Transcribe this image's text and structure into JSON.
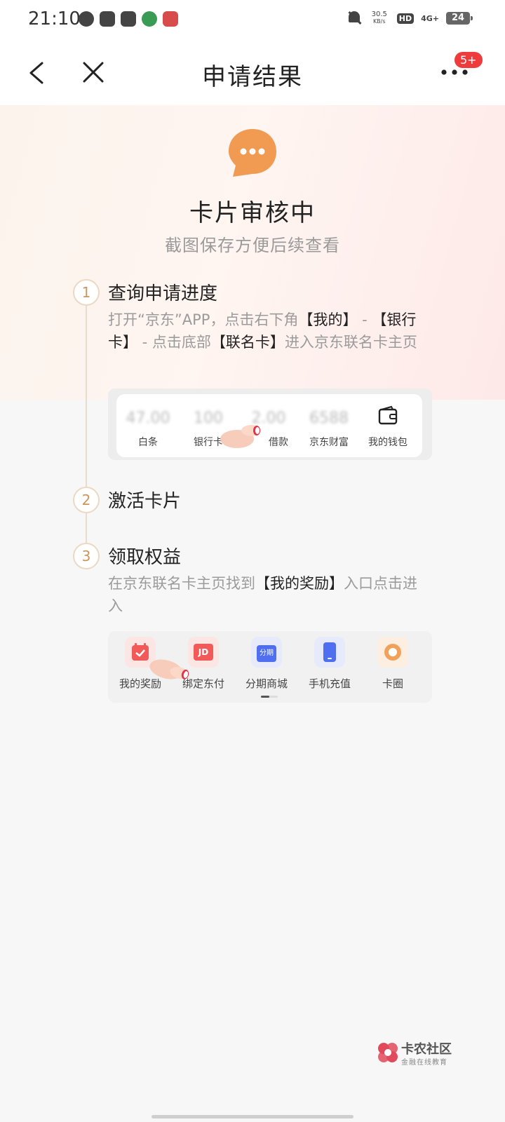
{
  "status_bar": {
    "time": "21:10",
    "speed_value": "30.5",
    "speed_unit": "KB/s",
    "hd": "HD",
    "network": "4G+",
    "battery": "24"
  },
  "nav": {
    "title": "申请结果",
    "badge": "5+"
  },
  "result": {
    "icon": "chat-bubble-icon",
    "title": "卡片审核中",
    "subtitle": "截图保存方便后续查看",
    "accent_color": "#f09a52"
  },
  "steps": [
    {
      "num": "1",
      "title": "查询申请进度",
      "desc_parts": [
        "打开“京东”APP，点击右下角",
        "【我的】",
        " - ",
        "【银行卡】",
        " - 点击底部",
        "【联名卡】",
        "进入京东联名卡主页"
      ]
    },
    {
      "num": "2",
      "title": "激活卡片"
    },
    {
      "num": "3",
      "title": "领取权益",
      "desc_parts": [
        "在京东联名卡主页找到",
        "【我的奖励】",
        "入口点击进入"
      ]
    }
  ],
  "demo1": {
    "items": [
      {
        "value": "47.00",
        "label": "白条"
      },
      {
        "value": "100",
        "label": "银行卡"
      },
      {
        "value": "2.00",
        "label": "借款"
      },
      {
        "value": "6588",
        "label": "京东财富"
      },
      {
        "value": "",
        "label": "我的钱包"
      }
    ]
  },
  "demo2": {
    "items": [
      {
        "label": "我的奖励",
        "icon": "calendar-check-icon",
        "color": "#f25a5a"
      },
      {
        "label": "绑定东付",
        "icon": "jd-card-icon",
        "color": "#f25a5a",
        "tile_text": "JD"
      },
      {
        "label": "分期商城",
        "icon": "shopping-bag-icon",
        "color": "#4f6ef0",
        "tile_text": "分期"
      },
      {
        "label": "手机充值",
        "icon": "phone-icon",
        "color": "#4f6ef0"
      },
      {
        "label": "卡圈",
        "icon": "ring-icon",
        "color": "#f0a15a"
      }
    ]
  },
  "watermark": {
    "name": "卡农社区",
    "tagline": "金融在线教育"
  }
}
